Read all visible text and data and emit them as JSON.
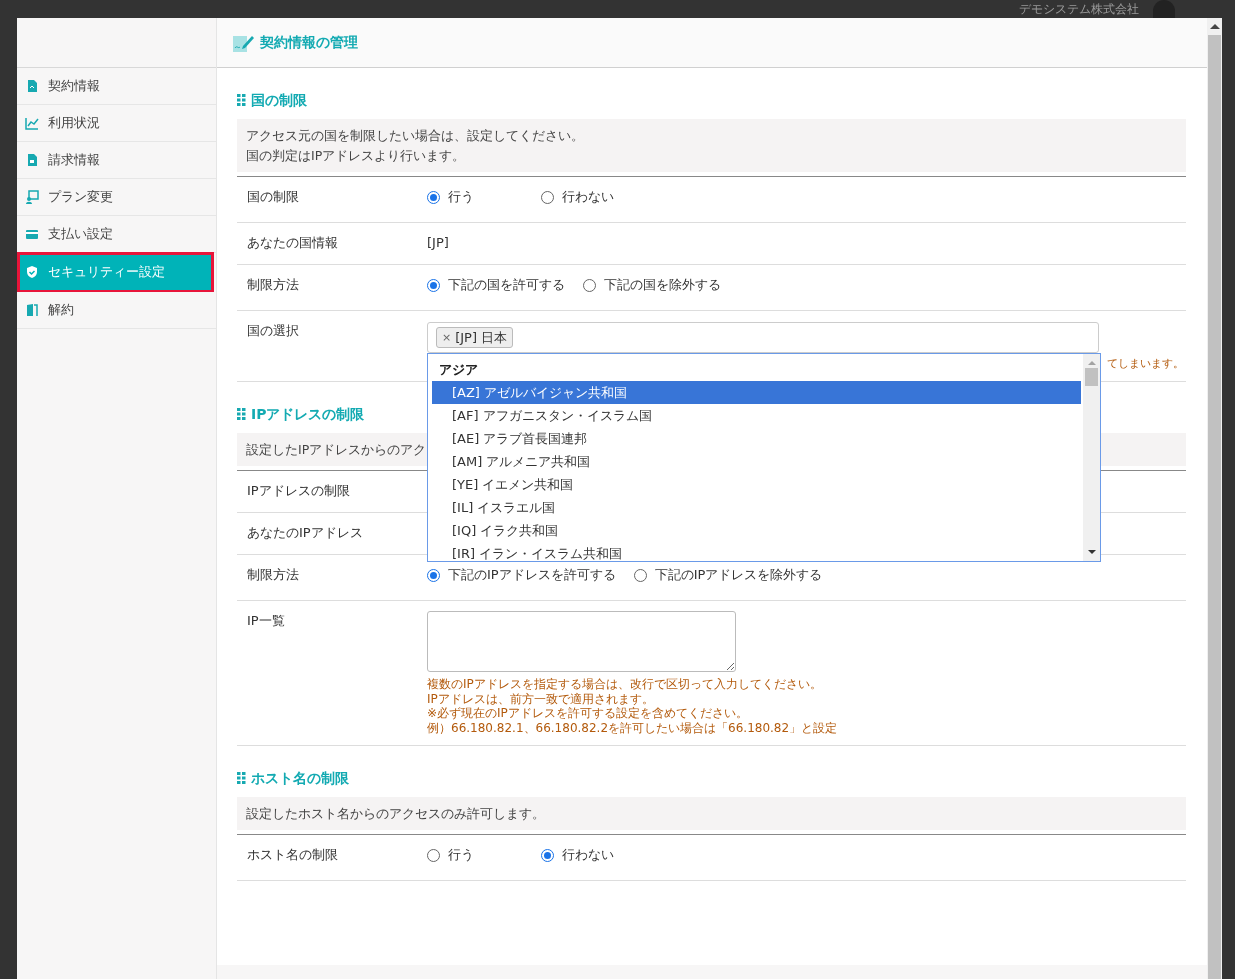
{
  "background": {
    "company": "デモシステム株式会社"
  },
  "sidebar": {
    "items": [
      {
        "label": "契約情報",
        "selected": false
      },
      {
        "label": "利用状況",
        "selected": false
      },
      {
        "label": "請求情報",
        "selected": false
      },
      {
        "label": "プラン変更",
        "selected": false
      },
      {
        "label": "支払い設定",
        "selected": false
      },
      {
        "label": "セキュリティー設定",
        "selected": true
      },
      {
        "label": "解約",
        "selected": false
      }
    ]
  },
  "header": {
    "title": "契約情報の管理"
  },
  "sections": [
    {
      "title": "国の制限",
      "description": [
        "アクセス元の国を制限したい場合は、設定してください。",
        "国の判定はIPアドレスより行います。"
      ],
      "rows": [
        {
          "kind": "radio",
          "label": "国の制限",
          "options": [
            {
              "label": "行う",
              "selected": true
            },
            {
              "label": "行わない",
              "selected": false
            }
          ]
        },
        {
          "kind": "text",
          "label": "あなたの国情報",
          "value": "[JP]"
        },
        {
          "kind": "radio",
          "label": "制限方法",
          "options": [
            {
              "label": "下記の国を許可する",
              "selected": true
            },
            {
              "label": "下記の国を除外する",
              "selected": false
            }
          ]
        },
        {
          "kind": "select",
          "label": "国の選択",
          "tags": [
            {
              "remove": "×",
              "label": "[JP] 日本"
            }
          ],
          "note": "てしまいます。",
          "dropdown": {
            "group": "アジア",
            "options": [
              {
                "label": "[AZ] アゼルバイジャン共和国",
                "selected": true
              },
              {
                "label": "[AF] アフガニスタン・イスラム国",
                "selected": false
              },
              {
                "label": "[AE] アラブ首長国連邦",
                "selected": false
              },
              {
                "label": "[AM] アルメニア共和国",
                "selected": false
              },
              {
                "label": "[YE] イエメン共和国",
                "selected": false
              },
              {
                "label": "[IL] イスラエル国",
                "selected": false
              },
              {
                "label": "[IQ] イラク共和国",
                "selected": false
              },
              {
                "label": "[IR] イラン・イスラム共和国",
                "selected": false
              }
            ]
          }
        }
      ]
    },
    {
      "title": "IPアドレスの制限",
      "description": [
        "設定したIPアドレスからのアク"
      ],
      "rows": [
        {
          "kind": "label",
          "label": "IPアドレスの制限"
        },
        {
          "kind": "label",
          "label": "あなたのIPアドレス"
        },
        {
          "kind": "radio",
          "label": "制限方法",
          "options": [
            {
              "label": "下記のIPアドレスを許可する",
              "selected": true
            },
            {
              "label": "下記のIPアドレスを除外する",
              "selected": false
            }
          ]
        },
        {
          "kind": "textarea",
          "label": "IP一覧",
          "notes": [
            "複数のIPアドレスを指定する場合は、改行で区切って入力してください。",
            "IPアドレスは、前方一致で適用されます。",
            "※必ず現在のIPアドレスを許可する設定を含めてください。",
            "例）66.180.82.1、66.180.82.2を許可したい場合は「66.180.82」と設定"
          ]
        }
      ]
    },
    {
      "title": "ホスト名の制限",
      "description": [
        "設定したホスト名からのアクセスのみ許可します。"
      ],
      "rows": [
        {
          "kind": "radio",
          "label": "ホスト名の制限",
          "options": [
            {
              "label": "行う",
              "selected": false
            },
            {
              "label": "行わない",
              "selected": true
            }
          ]
        }
      ]
    }
  ]
}
